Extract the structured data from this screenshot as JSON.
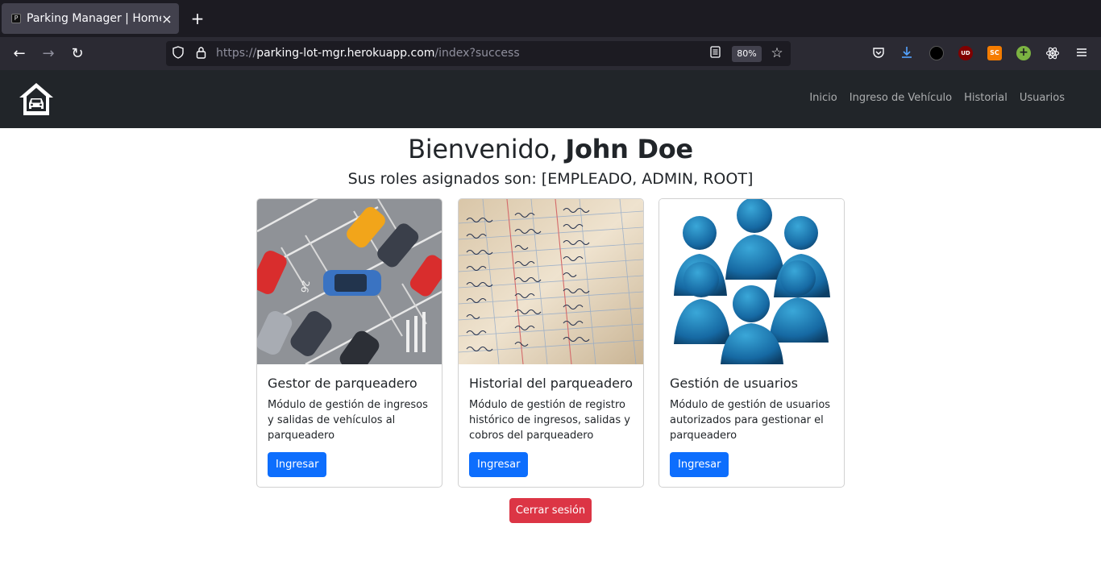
{
  "browser": {
    "tab_title": "Parking Manager | Home",
    "tab_close": "×",
    "new_tab": "+",
    "url_scheme": "https://",
    "url_host": "parking-lot-mgr.herokuapp.com",
    "url_path": "/index?success",
    "zoom": "80%",
    "back_icon": "←",
    "forward_icon": "→",
    "reload_icon": "↻",
    "extensions": [
      {
        "name": "pocket-icon",
        "label": "",
        "color": "#2b2a33"
      },
      {
        "name": "download-icon",
        "label": "",
        "color": "#2b2a33"
      },
      {
        "name": "circle-extension-icon",
        "label": "",
        "color": "#000000"
      },
      {
        "name": "ublock-icon",
        "label": "UD",
        "color": "#800000"
      },
      {
        "name": "sc-extension-icon",
        "label": "SC",
        "color": "#f57c00"
      },
      {
        "name": "plus-extension-icon",
        "label": "+",
        "color": "#7cb342"
      },
      {
        "name": "react-devtools-icon",
        "label": "",
        "color": "#2b2a33"
      }
    ]
  },
  "nav": {
    "links": [
      "Inicio",
      "Ingreso de Vehículo",
      "Historial",
      "Usuarios"
    ]
  },
  "welcome": {
    "greeting": "Bienvenido,",
    "user": "John Doe",
    "roles": "Sus roles asignados son: [EMPLEADO, ADMIN, ROOT]"
  },
  "cards": [
    {
      "title": "Gestor de parqueadero",
      "text": "Módulo de gestión de ingresos y salidas de vehículos al parqueadero",
      "button": "Ingresar"
    },
    {
      "title": "Historial del parqueadero",
      "text": "Módulo de gestión de registro histórico de ingresos, salidas y cobros del parqueadero",
      "button": "Ingresar"
    },
    {
      "title": "Gestión de usuarios",
      "text": "Módulo de gestión de usuarios autorizados para gestionar el parqueadero",
      "button": "Ingresar"
    }
  ],
  "logout": "Cerrar sesión",
  "colors": {
    "primary": "#0d6efd",
    "danger": "#dc3545",
    "navbar": "#212529"
  }
}
